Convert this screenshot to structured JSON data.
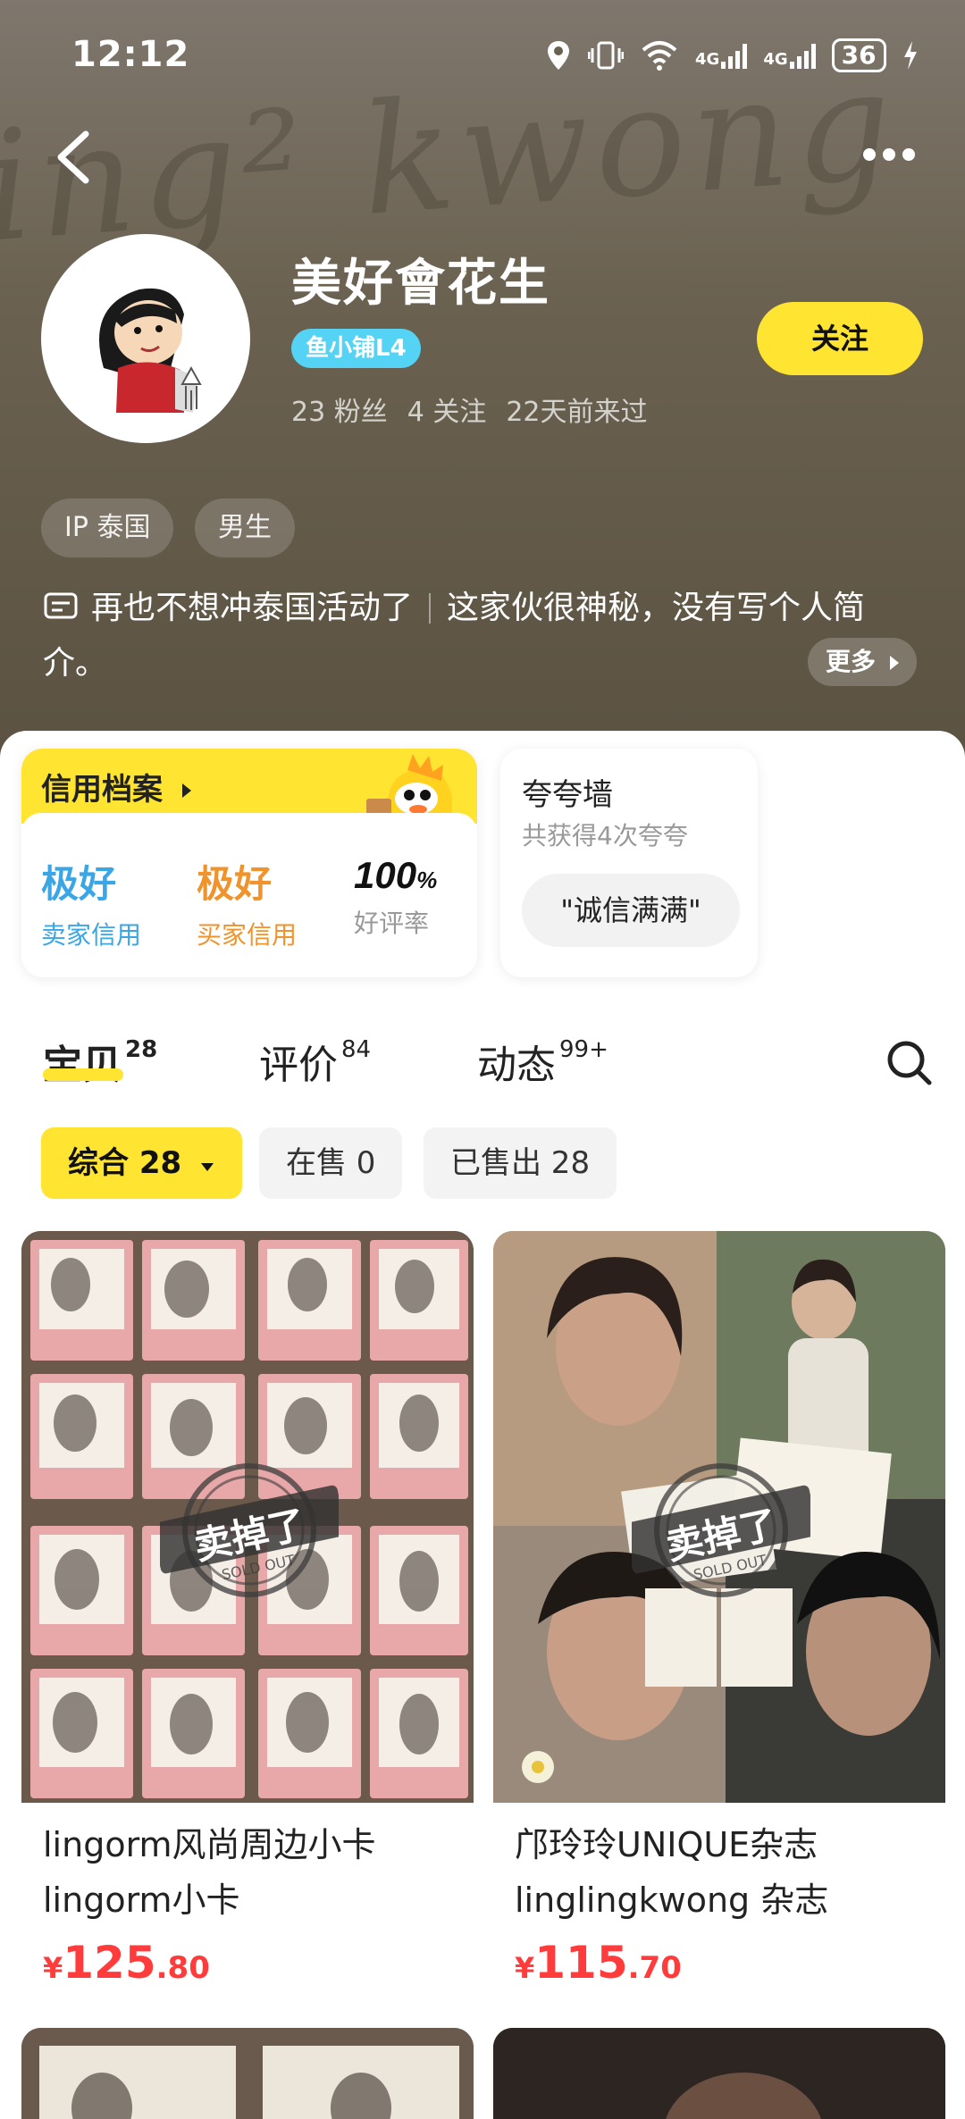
{
  "status_bar": {
    "time": "12:12",
    "network1": "4G",
    "network2": "4G",
    "battery": "36"
  },
  "header": {
    "background_text": "ing² kwong"
  },
  "profile": {
    "name": "美好會花生",
    "level_badge": "鱼小铺L4",
    "fans": "23 粉丝",
    "following": "4 关注",
    "last_seen": "22天前来过",
    "follow_label": "关注",
    "tags": [
      "IP 泰国",
      "男生"
    ],
    "bio_part1": "再也不想冲泰国活动了",
    "bio_part2": "这家伙很神秘，没有写个人简介。",
    "more_label": "更多"
  },
  "credit": {
    "title": "信用档案",
    "seller_value": "极好",
    "seller_label": "卖家信用",
    "buyer_value": "极好",
    "buyer_label": "买家信用",
    "rate_value": "100",
    "rate_unit": "%",
    "rate_label": "好评率"
  },
  "praise": {
    "title": "夸夸墙",
    "subtitle": "共获得4次夸夸",
    "chip": "\"诚信满满\""
  },
  "tabs": [
    {
      "label": "宝贝",
      "count": "28"
    },
    {
      "label": "评价",
      "count": "84"
    },
    {
      "label": "动态",
      "count": "99+"
    }
  ],
  "filters": [
    {
      "label": "综合 28"
    },
    {
      "label": "在售 0"
    },
    {
      "label": "已售出 28"
    }
  ],
  "products": [
    {
      "title": "lingorm风尚周边小卡 lingorm小卡",
      "price_symbol": "¥",
      "price_int": "125",
      "price_dec": ".80",
      "stamp": "卖掉了",
      "stamp_en": "SOLD OUT"
    },
    {
      "title": "邝玲玲UNIQUE杂志 linglingkwong 杂志",
      "price_symbol": "¥",
      "price_int": "115",
      "price_dec": ".70",
      "stamp": "卖掉了",
      "stamp_en": "SOLD OUT"
    }
  ],
  "colors": {
    "accent": "#ffe431",
    "price": "#ff3b3b",
    "seller_credit": "#3aa6e6",
    "buyer_credit": "#f0932b",
    "badge": "#55d3f5"
  }
}
